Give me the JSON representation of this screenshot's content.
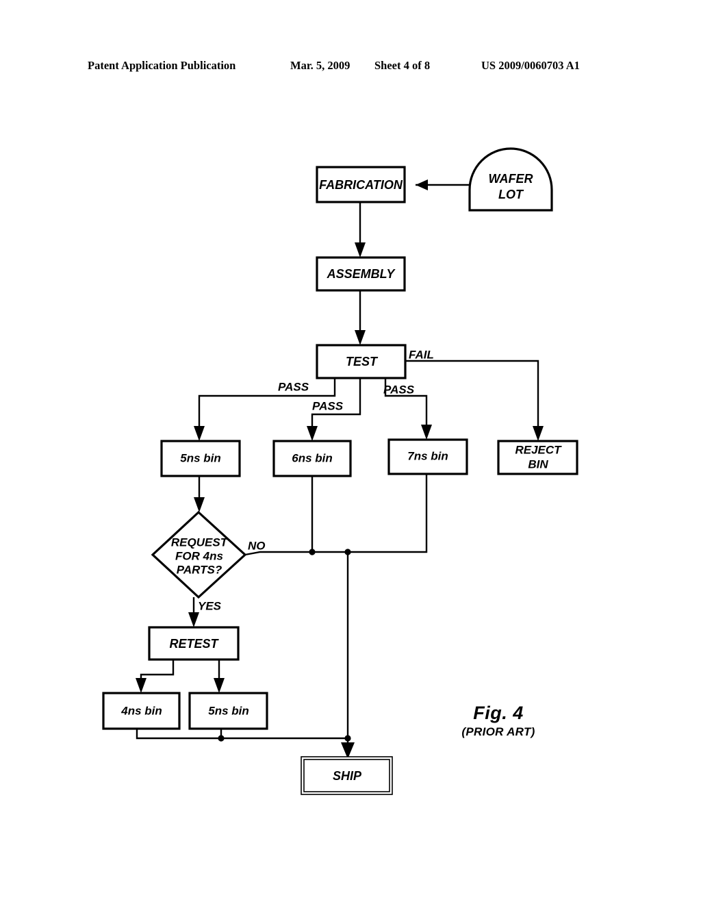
{
  "header": {
    "publication": "Patent Application Publication",
    "date": "Mar. 5, 2009",
    "sheet": "Sheet 4 of 8",
    "number": "US 2009/0060703 A1"
  },
  "figure": {
    "caption_main": "Fig. 4",
    "caption_sub": "(PRIOR ART)"
  },
  "chart_data": {
    "type": "diagram",
    "title": "Fig. 4 (PRIOR ART)",
    "diagram_kind": "flowchart",
    "nodes": [
      {
        "id": "wafer_lot",
        "label": "WAFER LOT",
        "shape": "dome"
      },
      {
        "id": "fabrication",
        "label": "FABRICATION",
        "shape": "rect"
      },
      {
        "id": "assembly",
        "label": "ASSEMBLY",
        "shape": "rect"
      },
      {
        "id": "test",
        "label": "TEST",
        "shape": "rect"
      },
      {
        "id": "bin5",
        "label": "5ns bin",
        "shape": "rect"
      },
      {
        "id": "bin6",
        "label": "6ns bin",
        "shape": "rect"
      },
      {
        "id": "bin7",
        "label": "7ns bin",
        "shape": "rect"
      },
      {
        "id": "reject",
        "label": "REJECT BIN",
        "shape": "rect"
      },
      {
        "id": "request",
        "label": "REQUEST FOR 4ns PARTS?",
        "shape": "diamond"
      },
      {
        "id": "retest",
        "label": "RETEST",
        "shape": "rect"
      },
      {
        "id": "bin4b",
        "label": "4ns bin",
        "shape": "rect"
      },
      {
        "id": "bin5b",
        "label": "5ns bin",
        "shape": "rect"
      },
      {
        "id": "ship",
        "label": "SHIP",
        "shape": "rect-dotted"
      }
    ],
    "edges": [
      {
        "from": "wafer_lot",
        "to": "fabrication",
        "label": ""
      },
      {
        "from": "fabrication",
        "to": "assembly",
        "label": ""
      },
      {
        "from": "assembly",
        "to": "test",
        "label": ""
      },
      {
        "from": "test",
        "to": "bin5",
        "label": "PASS"
      },
      {
        "from": "test",
        "to": "bin6",
        "label": "PASS"
      },
      {
        "from": "test",
        "to": "bin7",
        "label": "PASS"
      },
      {
        "from": "test",
        "to": "reject",
        "label": "FAIL"
      },
      {
        "from": "bin5",
        "to": "request",
        "label": ""
      },
      {
        "from": "request",
        "to": "retest",
        "label": "YES"
      },
      {
        "from": "request",
        "to": "ship",
        "label": "NO"
      },
      {
        "from": "bin6",
        "to": "ship",
        "label": ""
      },
      {
        "from": "bin7",
        "to": "ship",
        "label": ""
      },
      {
        "from": "retest",
        "to": "bin4b",
        "label": ""
      },
      {
        "from": "retest",
        "to": "bin5b",
        "label": ""
      },
      {
        "from": "bin4b",
        "to": "ship",
        "label": ""
      },
      {
        "from": "bin5b",
        "to": "ship",
        "label": ""
      }
    ]
  },
  "nodes": {
    "wafer_lot": {
      "line1": "WAFER",
      "line2": "LOT"
    },
    "fabrication": {
      "label": "FABRICATION"
    },
    "assembly": {
      "label": "ASSEMBLY"
    },
    "test": {
      "label": "TEST"
    },
    "bin5": {
      "label": "5ns bin"
    },
    "bin6": {
      "label": "6ns bin"
    },
    "bin7": {
      "label": "7ns bin"
    },
    "reject": {
      "line1": "REJECT",
      "line2": "BIN"
    },
    "request": {
      "line1": "REQUEST",
      "line2": "FOR 4ns",
      "line3": "PARTS?"
    },
    "retest": {
      "label": "RETEST"
    },
    "bin4b": {
      "label": "4ns bin"
    },
    "bin5b": {
      "label": "5ns bin"
    },
    "ship": {
      "label": "SHIP"
    }
  },
  "edge_labels": {
    "fail": "FAIL",
    "pass_left": "PASS",
    "pass_mid": "PASS",
    "pass_right": "PASS",
    "no": "NO",
    "yes": "YES"
  },
  "colors": {
    "ink": "#000000",
    "paper": "#ffffff"
  }
}
